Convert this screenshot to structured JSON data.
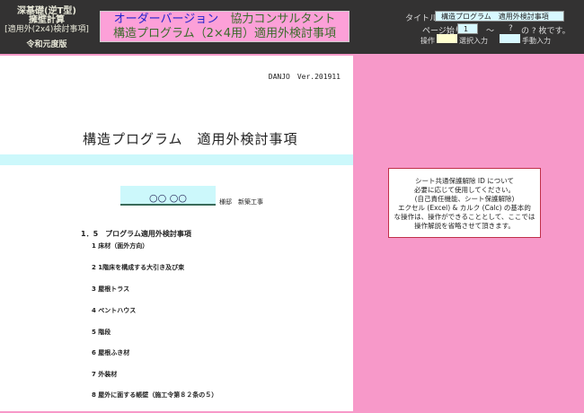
{
  "left": {
    "line1": "深基礎(逆T型)",
    "line2": "擁壁計算",
    "line3": "[適用外(2x4)検討事項]",
    "line4": "令和元度版"
  },
  "banner": {
    "line1a": "オーダーバージョン",
    "line1b": "協力コンサルタント",
    "line2": "構造プログラム（2×4用）適用外検討事項"
  },
  "controls": {
    "title_label": "タイトル",
    "title_value": "構造プログラム　適用外検討事項",
    "page_label": "ページ始り",
    "page_start": "1",
    "tilde": "～",
    "page_end": "?",
    "page_total": "の ? 枚です。",
    "op_label": "操作",
    "select_label": "選択入力",
    "manual_label": "手動入力"
  },
  "doc": {
    "header": "DANJO　Ver.201911",
    "title": "構造プログラム　適用外検討事項",
    "name": "○○ ○○",
    "sama": "様邸　新築工事",
    "section": "1．5　プログラム適用外検討事項",
    "items": [
      "1 床材（面外方向）",
      "2 1階床を構成する大引き及び束",
      "3 屋根トラス",
      "4 ペントハウス",
      "5 階段",
      "6 屋根ふき材",
      "7 外装材",
      "8 屋外に面する帳壁（施工令第８２条の５）"
    ]
  },
  "note": [
    "シート共通保護解除 ID について",
    "必要に応じて使用してください。",
    "(自己責任機能、シート保護解除)",
    "エクセル (Excel) & カルク (Calc) の基本的",
    "な操作は、操作ができることとして、ここでは",
    "操作解説を省略させて頂きます。"
  ]
}
